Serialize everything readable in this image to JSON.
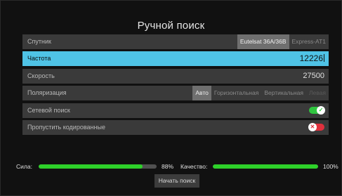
{
  "title": "Ручной поиск",
  "rows": [
    {
      "label": "Спутник",
      "options": [
        "Eutelsat 36A/36B",
        "Express-AT1"
      ],
      "selected_option": "Eutelsat 36A/36B"
    },
    {
      "label": "Частота",
      "value": "12226"
    },
    {
      "label": "Скорость",
      "value": "27500"
    },
    {
      "label": "Поляризация",
      "options": [
        "Авто",
        "Горизонтальная",
        "Вертикальная",
        "Левая"
      ],
      "selected_option": "Авто"
    },
    {
      "label": "Сетевой поиск",
      "toggle": "on"
    },
    {
      "label": "Пропустить кодированные",
      "toggle": "off"
    }
  ],
  "signal": {
    "label": "Сила:",
    "percent_text": "88%",
    "level": 0.88
  },
  "quality": {
    "label": "Качество:",
    "percent_text": "100%",
    "level": 1.0
  },
  "start_button": "Начать поиск",
  "colors": {
    "accent": "#4fc3e6",
    "bar_fill": "#2ed12a",
    "toggle_on": "#2fc53f",
    "toggle_off": "#e0303d"
  },
  "icons": {
    "toggle_on": "check-icon",
    "toggle_off": "cross-icon"
  }
}
